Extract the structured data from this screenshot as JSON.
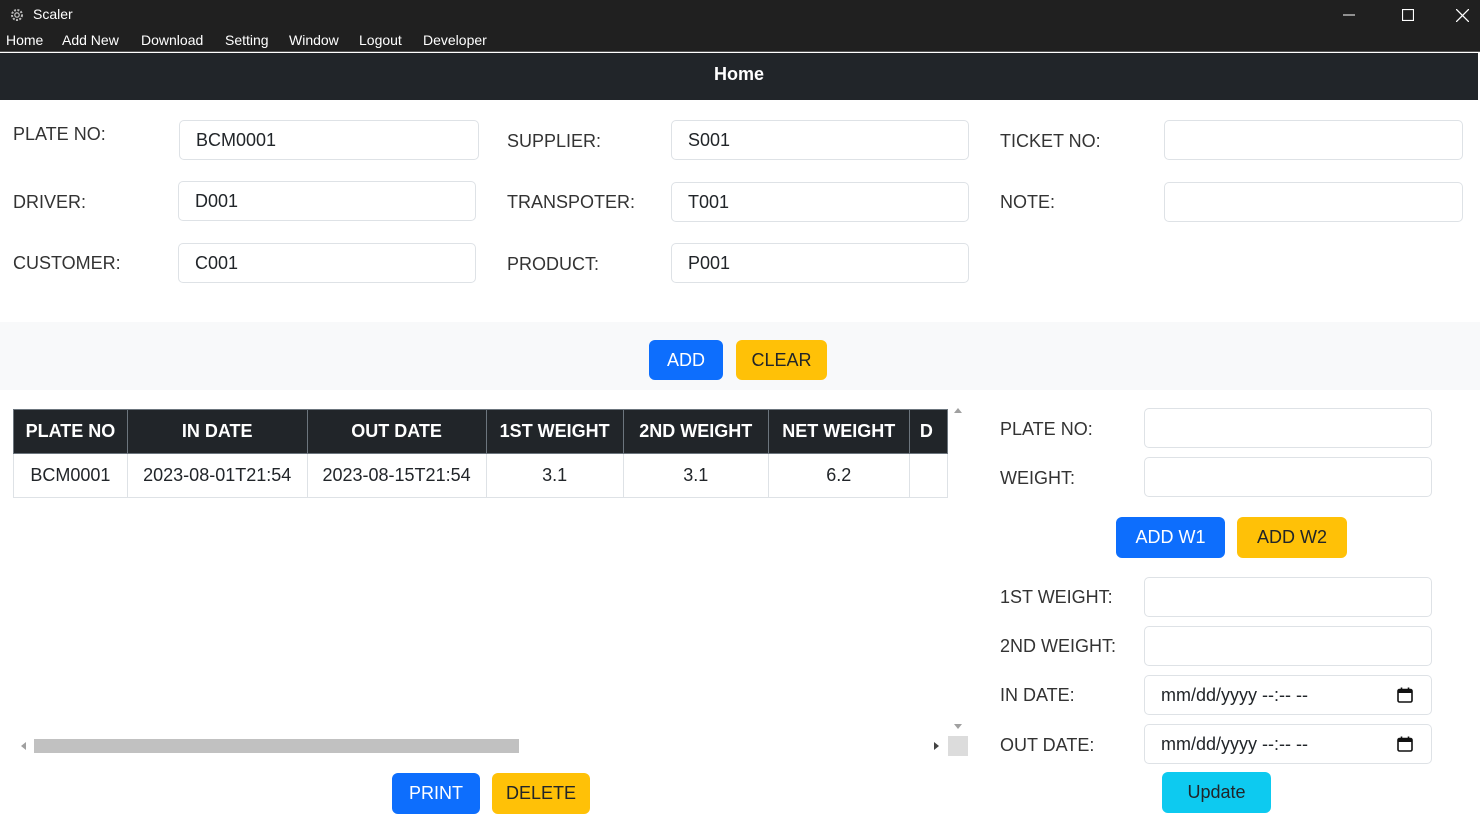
{
  "window": {
    "title": "Scaler",
    "app_icon": "gear-icon",
    "controls": [
      "minimize-icon",
      "maximize-icon",
      "close-icon"
    ]
  },
  "menu": [
    "Home",
    "Add New",
    "Download",
    "Setting",
    "Window",
    "Logout",
    "Developer"
  ],
  "header": {
    "title": "Home"
  },
  "form": {
    "plate_no": {
      "label": "PLATE NO:",
      "value": "BCM0001"
    },
    "supplier": {
      "label": "SUPPLIER:",
      "value": "S001"
    },
    "ticket_no": {
      "label": "TICKET NO:",
      "value": ""
    },
    "driver": {
      "label": "DRIVER:",
      "value": "D001"
    },
    "transporter": {
      "label": "TRANSPOTER:",
      "value": "T001"
    },
    "note": {
      "label": "NOTE:",
      "value": ""
    },
    "customer": {
      "label": "CUSTOMER:",
      "value": "C001"
    },
    "product": {
      "label": "PRODUCT:",
      "value": "P001"
    },
    "add_label": "ADD",
    "clear_label": "CLEAR"
  },
  "table": {
    "columns": [
      "PLATE NO",
      "IN DATE",
      "OUT DATE",
      "1ST WEIGHT",
      "2ND WEIGHT",
      "NET WEIGHT",
      "D"
    ],
    "rows": [
      [
        "BCM0001",
        "2023-08-01T21:54",
        "2023-08-15T21:54",
        "3.1",
        "3.1",
        "6.2",
        ""
      ]
    ],
    "print_label": "PRINT",
    "delete_label": "DELETE"
  },
  "weigh_panel": {
    "plate_no": {
      "label": "PLATE NO:",
      "value": ""
    },
    "weight": {
      "label": "WEIGHT:",
      "value": ""
    },
    "add_w1_label": "ADD W1",
    "add_w2_label": "ADD W2",
    "first_weight": {
      "label": "1ST WEIGHT:",
      "value": ""
    },
    "second_weight": {
      "label": "2ND WEIGHT:",
      "value": ""
    },
    "in_date": {
      "label": "IN DATE:",
      "placeholder": "mm/dd/yyyy --:-- --"
    },
    "out_date": {
      "label": "OUT DATE:",
      "placeholder": "mm/dd/yyyy --:-- --"
    },
    "date_icon": "calendar-icon",
    "update_label": "Update"
  },
  "colors": {
    "primary": "#0d6efd",
    "warning": "#ffc107",
    "info": "#0dcaf0",
    "dark": "#212529",
    "titlebar": "#202020"
  }
}
